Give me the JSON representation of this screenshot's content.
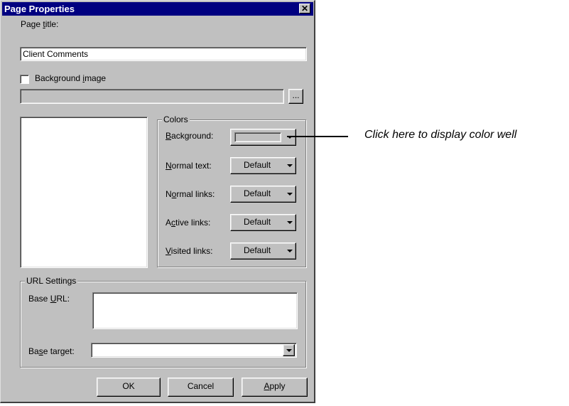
{
  "window": {
    "title": "Page Properties",
    "close_glyph": "✕"
  },
  "page_title": {
    "label_pre": "Page ",
    "label_key": "t",
    "label_post": "itle:",
    "value": "Client Comments"
  },
  "background_image": {
    "label_pre": "Background ",
    "label_key": "i",
    "label_post": "mage",
    "checked": false,
    "path_value": "",
    "browse_label": "..."
  },
  "colors": {
    "group_title": "Colors",
    "rows": [
      {
        "pre": "",
        "key": "B",
        "post": "ackground:",
        "value": ""
      },
      {
        "pre": "",
        "key": "N",
        "post": "ormal text:",
        "value": "Default"
      },
      {
        "pre": "N",
        "key": "o",
        "post": "rmal links:",
        "value": "Default"
      },
      {
        "pre": "A",
        "key": "c",
        "post": "tive links:",
        "value": "Default"
      },
      {
        "pre": "",
        "key": "V",
        "post": "isited links:",
        "value": "Default"
      }
    ]
  },
  "url_settings": {
    "group_title": "URL Settings",
    "base_url": {
      "pre": "Base ",
      "key": "U",
      "post": "RL:",
      "value": ""
    },
    "base_target": {
      "pre": "Ba",
      "key": "s",
      "post": "e target:",
      "value": ""
    }
  },
  "buttons": {
    "ok": "OK",
    "cancel": "Cancel",
    "apply_key": "A",
    "apply_post": "pply"
  },
  "annotation": {
    "text": "Click here to display color well"
  }
}
